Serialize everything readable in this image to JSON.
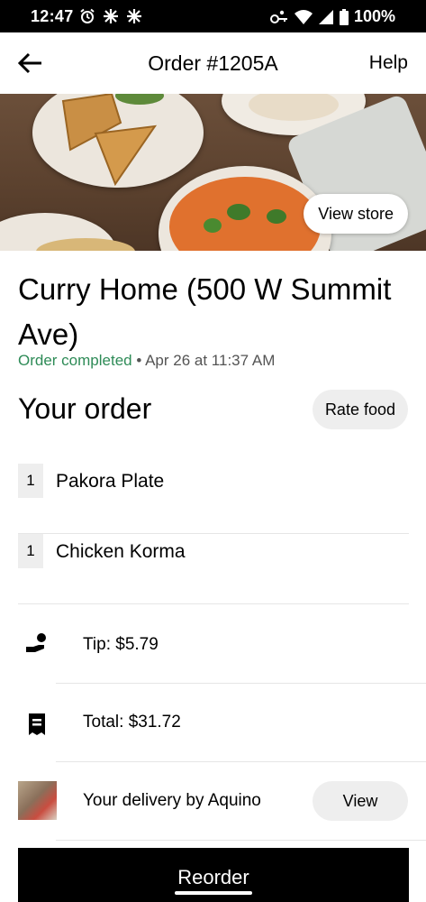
{
  "status_bar": {
    "time": "12:47",
    "battery": "100%"
  },
  "header": {
    "title": "Order #1205A",
    "help_label": "Help"
  },
  "hero": {
    "view_store_label": "View store"
  },
  "store": {
    "name": "Curry Home (500 W Summit Ave)",
    "status": "Order completed",
    "separator": " • ",
    "date": "Apr 26 at 11:37 AM"
  },
  "order": {
    "heading": "Your order",
    "rate_food_label": "Rate food",
    "items": [
      {
        "qty": "1",
        "name": "Pakora Plate"
      },
      {
        "qty": "1",
        "name": "Chicken Korma"
      }
    ]
  },
  "summary": {
    "tip": "Tip: $5.79",
    "total": "Total: $31.72",
    "delivery": "Your delivery by Aquino",
    "view_label": "View"
  },
  "footer": {
    "reorder_label": "Reorder"
  },
  "colors": {
    "status_green": "#2e8b57",
    "pill_bg": "#eeeeee",
    "primary": "#000000"
  }
}
